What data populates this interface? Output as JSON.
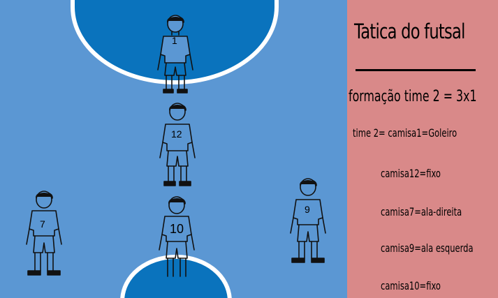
{
  "court": {
    "surface_color": "#5b97d3",
    "area_color": "#0a73bd",
    "line_color": "#ffffff"
  },
  "players": [
    {
      "name": "player-goleiro",
      "number": "1"
    },
    {
      "name": "player-fixo-12",
      "number": "12"
    },
    {
      "name": "player-ala-direita",
      "number": "7"
    },
    {
      "name": "player-fixo-10",
      "number": "10"
    },
    {
      "name": "player-ala-esquerda",
      "number": "9"
    }
  ],
  "panel": {
    "background": "#d98989",
    "title": "Tatica do futsal",
    "formation": "formação time 2 = 3x1",
    "lines": [
      "time 2= camisa1=Goleiro",
      "camisa12=fixo",
      "camisa7=ala-direita",
      "camisa9=ala esquerda",
      "camisa10=fixo"
    ]
  }
}
